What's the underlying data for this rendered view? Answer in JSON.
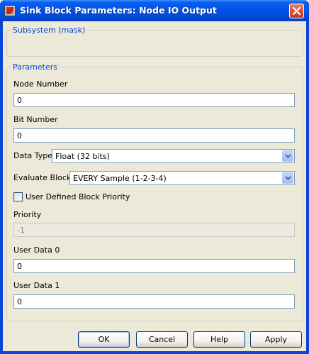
{
  "window": {
    "title": "Sink Block Parameters: Node IO Output"
  },
  "subsystem": {
    "legend": "Subsystem (mask)"
  },
  "parameters": {
    "legend": "Parameters",
    "node_number": {
      "label": "Node Number",
      "value": "0"
    },
    "bit_number": {
      "label": "Bit Number",
      "value": "0"
    },
    "data_type": {
      "label": "Data Type",
      "value": "Float (32 bits)"
    },
    "evaluate_blocks": {
      "label": "Evaluate Blocks",
      "value": "EVERY Sample (1-2-3-4)"
    },
    "user_defined_priority": {
      "label": "User Defined Block Priority",
      "checked": false
    },
    "priority": {
      "label": "Priority",
      "value": "-1"
    },
    "user_data_0": {
      "label": "User Data 0",
      "value": "0"
    },
    "user_data_1": {
      "label": "User Data 1",
      "value": "0"
    }
  },
  "buttons": {
    "ok": "OK",
    "cancel": "Cancel",
    "help": "Help",
    "apply": "Apply"
  },
  "icons": {
    "close": "close-icon",
    "app": "simulink-block-icon",
    "dropdown": "chevron-down-icon"
  },
  "colors": {
    "titlebar": "#0054e3",
    "legend": "#0046d5",
    "dialog_bg": "#ece9d8"
  }
}
